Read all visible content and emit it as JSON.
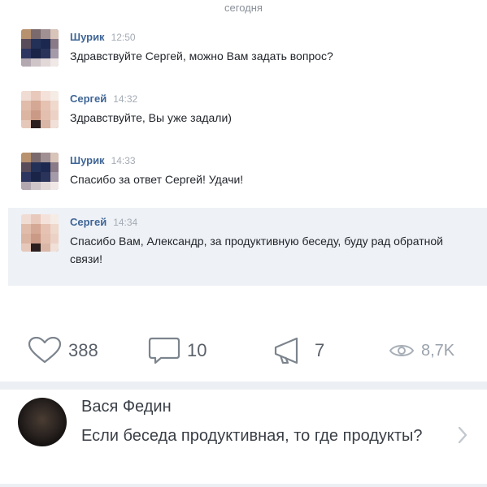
{
  "date_header": "сегодня",
  "messages": [
    {
      "sender": "Шурик",
      "time": "12:50",
      "text": "Здравствуйте Сергей, можно Вам задать вопрос?"
    },
    {
      "sender": "Сергей",
      "time": "14:32",
      "text": "Здравствуйте, Вы уже задали)"
    },
    {
      "sender": "Шурик",
      "time": "14:33",
      "text": "Спасибо за ответ Сергей! Удачи!"
    },
    {
      "sender": "Сергей",
      "time": "14:34",
      "text": "Спасибо Вам, Александр, за продуктивную беседу, буду рад обратной связи!"
    }
  ],
  "actions": {
    "likes": "388",
    "comments": "10",
    "reposts": "7",
    "views": "8,7K"
  },
  "comment": {
    "author": "Вася Федин",
    "text": "Если беседа продуктивная, то где продукты?"
  },
  "colors": {
    "link_blue": "#3f6596",
    "highlight_bg": "#eef1f6",
    "divider": "#eceff3"
  }
}
